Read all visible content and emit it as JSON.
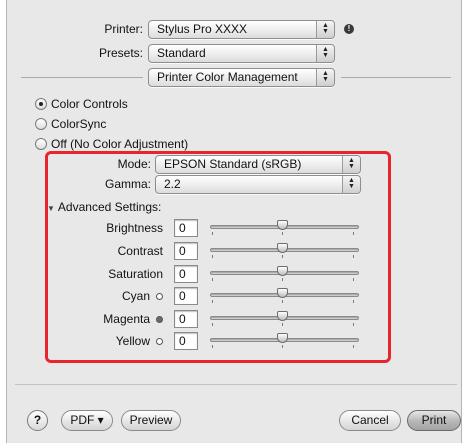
{
  "printer": {
    "label": "Printer:",
    "value": "Stylus Pro XXXX"
  },
  "presets": {
    "label": "Presets:",
    "value": "Standard"
  },
  "panel": {
    "value": "Printer Color Management"
  },
  "color_modes": [
    {
      "label": "Color Controls",
      "selected": true
    },
    {
      "label": "ColorSync",
      "selected": false
    },
    {
      "label": "Off (No Color Adjustment)",
      "selected": false
    }
  ],
  "mode": {
    "label": "Mode:",
    "value": "EPSON Standard (sRGB)"
  },
  "gamma": {
    "label": "Gamma:",
    "value": "2.2"
  },
  "advanced": {
    "label": "Advanced Settings:"
  },
  "adjustments": [
    {
      "label": "Brightness",
      "value": "0",
      "dot": ""
    },
    {
      "label": "Contrast",
      "value": "0",
      "dot": ""
    },
    {
      "label": "Saturation",
      "value": "0",
      "dot": ""
    },
    {
      "label": "Cyan",
      "value": "0",
      "dot": "hollow"
    },
    {
      "label": "Magenta",
      "value": "0",
      "dot": "filled"
    },
    {
      "label": "Yellow",
      "value": "0",
      "dot": "hollow"
    }
  ],
  "buttons": {
    "help": "?",
    "pdf": "PDF ▾",
    "preview": "Preview",
    "cancel": "Cancel",
    "print": "Print"
  },
  "colors": {
    "highlight_border": "#e8252d",
    "dialog_bg": "#e8e8e8"
  }
}
